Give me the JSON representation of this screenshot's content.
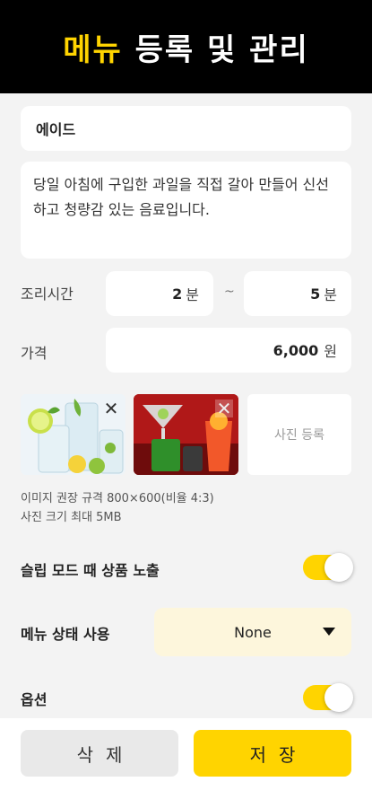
{
  "header": {
    "title_accent": "메뉴",
    "title_rest": "등록 및 관리"
  },
  "menu": {
    "name": "에이드",
    "description": "당일 아침에 구입한 과일을 직접 갈아 만들어 신선하고 청량감 있는 음료입니다."
  },
  "cook_time": {
    "label": "조리시간",
    "min": "2",
    "max": "5",
    "unit": "분",
    "separator": "~"
  },
  "price": {
    "label": "가격",
    "value": "6,000",
    "unit": "원"
  },
  "photos": {
    "items": [
      {
        "icon": "lemonade-photo",
        "close_icon": "close-icon",
        "close": "✕"
      },
      {
        "icon": "cocktail-photo",
        "close_icon": "close-icon",
        "close": "✕"
      }
    ],
    "add_label": "사진 등록",
    "guide_line1": "이미지 권장 규격 800×600(비율 4:3)",
    "guide_line2": "사진 크기 최대 5MB"
  },
  "options": {
    "slim_mode_label": "슬립 모드 때 상품 노출",
    "slim_mode_on": true,
    "status_label": "메뉴 상태 사용",
    "status_value": "None",
    "option_label": "옵션",
    "option_on": true
  },
  "buttons": {
    "delete": "삭제",
    "save": "저장"
  },
  "colors": {
    "accent": "#ffd400",
    "header_bg": "#000000",
    "select_bg": "#fdf6dc"
  }
}
